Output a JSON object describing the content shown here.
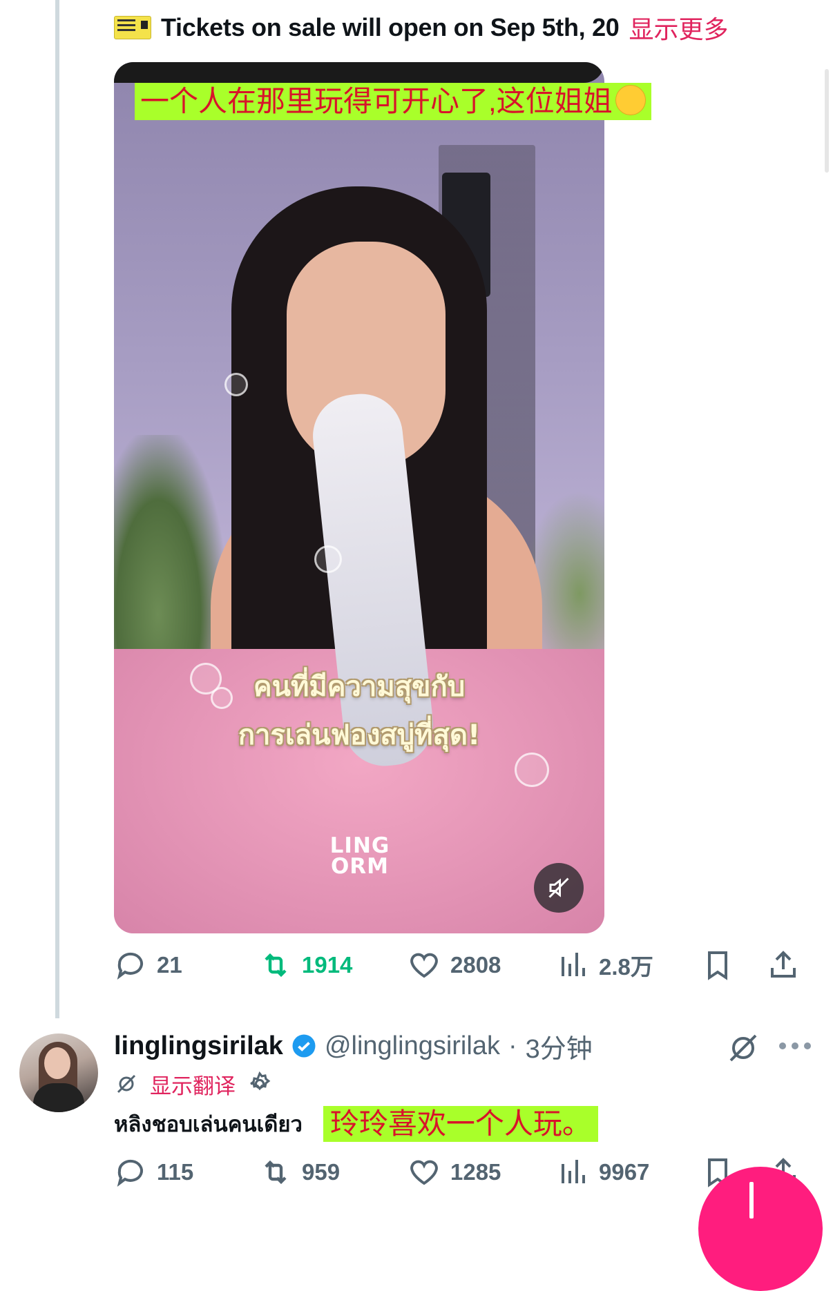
{
  "tweet1": {
    "text": "Tickets on sale will open on Sep 5th, 20",
    "show_more": "显示更多",
    "video": {
      "caption_cn": "一个人在那里玩得可开心了,这位姐姐",
      "caption_thai_line1": "คนที่มีความสุขกับ",
      "caption_thai_line2": "การเล่นฟองสบู่ที่สุด!",
      "logo_line1": "LING",
      "logo_line2": "ORM"
    },
    "stats": {
      "replies": "21",
      "retweets": "1914",
      "likes": "2808",
      "views": "2.8万"
    }
  },
  "tweet2": {
    "display_name": "linglingsirilak",
    "handle": "@linglingsirilak",
    "separator": "·",
    "time": "3分钟",
    "translate_label": "显示翻译",
    "body_thai": "หลิงชอบเล่นคนเดียว",
    "caption_cn": "玲玲喜欢一个人玩。",
    "stats": {
      "replies": "115",
      "retweets": "959",
      "likes": "1285",
      "views": "9967"
    }
  },
  "colors": {
    "accent_pink": "#e0245e",
    "retweet_green": "#00ba7c",
    "verified_blue": "#1d9bf0",
    "caption_bg": "#a9ff2a",
    "caption_text": "#d8142a",
    "fab": "#ff1d7e"
  },
  "icons": [
    "ticket-icon",
    "mute-icon",
    "reply-icon",
    "retweet-icon",
    "like-icon",
    "views-icon",
    "bookmark-icon",
    "share-icon",
    "verified-icon",
    "grok-icon",
    "more-icon",
    "translate-icon",
    "settings-icon",
    "compose-icon"
  ]
}
